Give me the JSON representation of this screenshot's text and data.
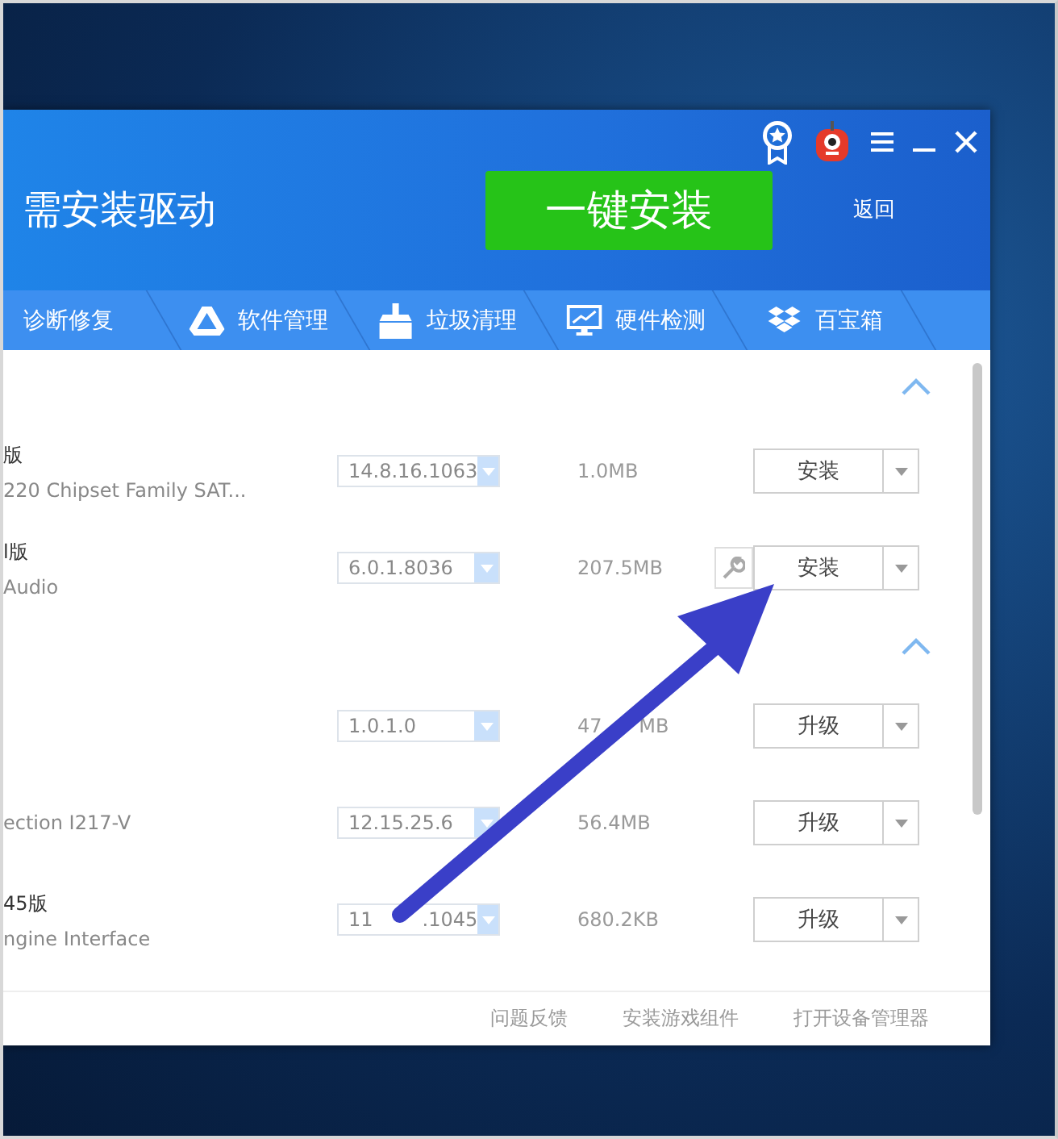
{
  "window": {
    "title": "需安装驱动",
    "primary_button": "一键安装",
    "back_link": "返回"
  },
  "tabs": [
    {
      "label": "诊断修复"
    },
    {
      "label": "软件管理"
    },
    {
      "label": "垃圾清理"
    },
    {
      "label": "硬件检测"
    },
    {
      "label": "百宝箱"
    }
  ],
  "groups": [
    {
      "expanded": true,
      "rows": [
        {
          "title": "版",
          "subtitle": "220 Chipset Family SAT...",
          "version": "14.8.16.1063",
          "size": "1.0MB",
          "repair_icon": false,
          "action": "安装"
        },
        {
          "title": "l版",
          "subtitle": "Audio",
          "version": "6.0.1.8036",
          "size": "207.5MB",
          "repair_icon": true,
          "action": "安装"
        }
      ]
    },
    {
      "expanded": true,
      "rows": [
        {
          "version": "1.0.1.0",
          "size": "47      MB",
          "repair_icon": false,
          "action": "升级"
        },
        {
          "subtitle": "ection I217-V",
          "version": "12.15.25.6",
          "size": "56.4MB",
          "repair_icon": false,
          "action": "升级"
        },
        {
          "title": "45版",
          "subtitle": "ngine Interface",
          "version": "11        .1045",
          "size": "680.2KB",
          "repair_icon": false,
          "action": "升级"
        }
      ]
    }
  ],
  "footer_links": [
    "问题反馈",
    "安装游戏组件",
    "打开设备管理器"
  ]
}
